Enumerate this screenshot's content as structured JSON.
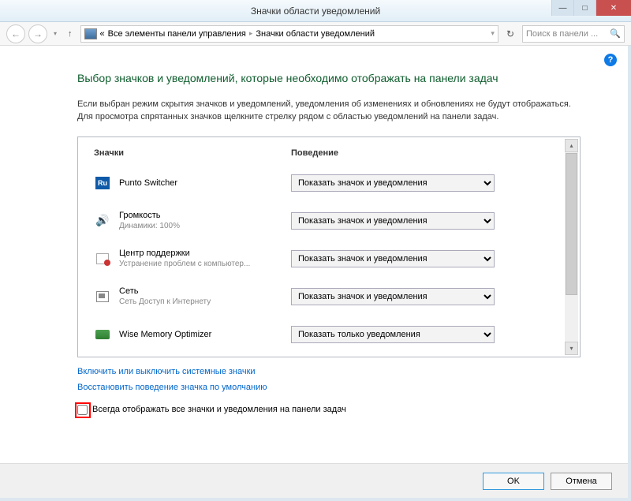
{
  "window": {
    "title": "Значки области уведомлений"
  },
  "breadcrumb": {
    "prefix": "«",
    "item1": "Все элементы панели управления",
    "item2": "Значки области уведомлений"
  },
  "search": {
    "placeholder": "Поиск в панели ..."
  },
  "heading": "Выбор значков и уведомлений, которые необходимо отображать на панели задач",
  "description": "Если выбран режим скрытия значков и уведомлений, уведомления об изменениях и обновлениях не будут отображаться. Для просмотра спрятанных значков щелкните стрелку рядом с областью уведомлений на панели задач.",
  "columns": {
    "icons": "Значки",
    "behavior": "Поведение"
  },
  "behaviorOptions": {
    "showIconAndNotif": "Показать значок и уведомления",
    "showNotifOnly": "Показать только уведомления"
  },
  "items": [
    {
      "icon": "ru",
      "name": "Punto Switcher",
      "sub": "",
      "behavior": "showIconAndNotif"
    },
    {
      "icon": "vol",
      "name": "Громкость",
      "sub": "Динамики: 100%",
      "behavior": "showIconAndNotif"
    },
    {
      "icon": "flag",
      "name": "Центр поддержки",
      "sub": "Устранение проблем с компьютер...",
      "behavior": "showIconAndNotif"
    },
    {
      "icon": "net",
      "name": "Сеть",
      "sub": "Сеть Доступ к Интернету",
      "behavior": "showIconAndNotif"
    },
    {
      "icon": "wise",
      "name": "Wise Memory Optimizer",
      "sub": "",
      "behavior": "showNotifOnly"
    }
  ],
  "links": {
    "toggleSystem": "Включить или выключить системные значки",
    "restoreDefault": "Восстановить поведение значка по умолчанию"
  },
  "checkbox": {
    "label": "Всегда отображать все значки и уведомления на панели задач"
  },
  "buttons": {
    "ok": "OK",
    "cancel": "Отмена"
  }
}
